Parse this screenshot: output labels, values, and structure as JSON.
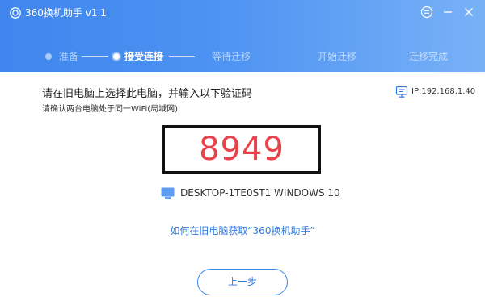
{
  "app": {
    "title": "360换机助手 v1.1"
  },
  "titlebar": {
    "icons": [
      "360-logo-icon",
      "feedback-icon",
      "minimize-icon",
      "close-icon"
    ]
  },
  "steps": [
    {
      "label": "准备",
      "state": "done"
    },
    {
      "label": "接受连接",
      "state": "active"
    },
    {
      "label": "等待迁移",
      "state": "pending"
    },
    {
      "label": "开始迁移",
      "state": "pending"
    },
    {
      "label": "迁移完成",
      "state": "pending"
    }
  ],
  "main": {
    "title": "请在旧电脑上选择此电脑，并输入以下验证码",
    "subtitle": "请确认两台电脑处于同一WiFi(局域网)",
    "ip_label": "IP:192.168.1.40",
    "verification_code": "8949",
    "device_name": "DESKTOP-1TE0ST1 WINDOWS 10",
    "help_link": "如何在旧电脑获取“360换机助手”",
    "prev_button": "上一步"
  },
  "colors": {
    "header_start": "#3f86ee",
    "header_end": "#78b1f6",
    "code": "#e8434a",
    "link": "#2e7be6",
    "button_border": "#3d86ec"
  }
}
